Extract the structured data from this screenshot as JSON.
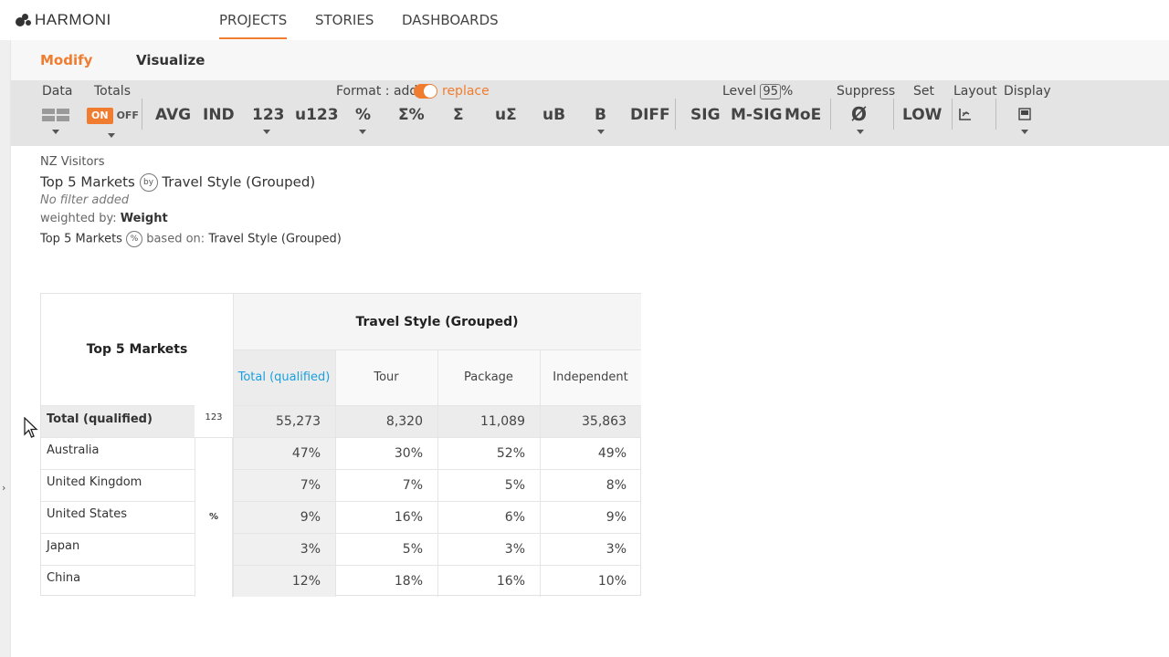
{
  "app": {
    "logo_text": "HARMONI"
  },
  "nav": {
    "tabs": [
      "PROJECTS",
      "STORIES",
      "DASHBOARDS"
    ],
    "active": "PROJECTS"
  },
  "subnav": {
    "modify": "Modify",
    "visualize": "Visualize"
  },
  "toolbar": {
    "data_label": "Data",
    "totals_label": "Totals",
    "totals_on": "ON",
    "totals_off": "OFF",
    "format_label": "Format : add",
    "format_replace": "replace",
    "buttons": [
      "AVG",
      "IND",
      "123",
      "u123",
      "%",
      "Σ%",
      "Σ",
      "uΣ",
      "uB",
      "B",
      "DIFF",
      "SIG",
      "M-SIG",
      "MoE"
    ],
    "level_label": "Level",
    "level_value": "95",
    "level_unit": "%",
    "suppress_label": "Suppress",
    "suppress_symbol": "Ø",
    "set_label": "Set",
    "set_value": "LOW",
    "layout_label": "Layout",
    "display_label": "Display"
  },
  "info": {
    "dataset": "NZ Visitors",
    "row_var": "Top 5 Markets",
    "by_badge": "by",
    "col_var": "Travel Style (Grouped)",
    "filter": "No filter added",
    "weighted_prefix": "weighted by:",
    "weight": "Weight",
    "pct_row_var": "Top 5 Markets",
    "pct_badge": "%",
    "based_on_prefix": "based on:",
    "based_on": "Travel Style (Grouped)"
  },
  "table": {
    "row_header": "Top 5 Markets",
    "col_group_header": "Travel Style (Grouped)",
    "columns": [
      "Total (qualified)",
      "Tour",
      "Package",
      "Independent"
    ],
    "total_row": {
      "label": "Total (qualified)",
      "stat": "123",
      "values": [
        "55,273",
        "8,320",
        "11,089",
        "35,863"
      ]
    },
    "pct_stat": "%",
    "rows": [
      {
        "label": "Australia",
        "values": [
          "47%",
          "30%",
          "52%",
          "49%"
        ]
      },
      {
        "label": "United Kingdom",
        "values": [
          "7%",
          "7%",
          "5%",
          "8%"
        ]
      },
      {
        "label": "United States",
        "values": [
          "9%",
          "16%",
          "6%",
          "9%"
        ]
      },
      {
        "label": "Japan",
        "values": [
          "3%",
          "5%",
          "3%",
          "3%"
        ]
      },
      {
        "label": "China",
        "values": [
          "12%",
          "18%",
          "16%",
          "10%"
        ]
      }
    ]
  },
  "colors": {
    "accent": "#f07d2f",
    "link_blue": "#1a9fe0",
    "toolbar_bg": "#e4e4e4"
  }
}
